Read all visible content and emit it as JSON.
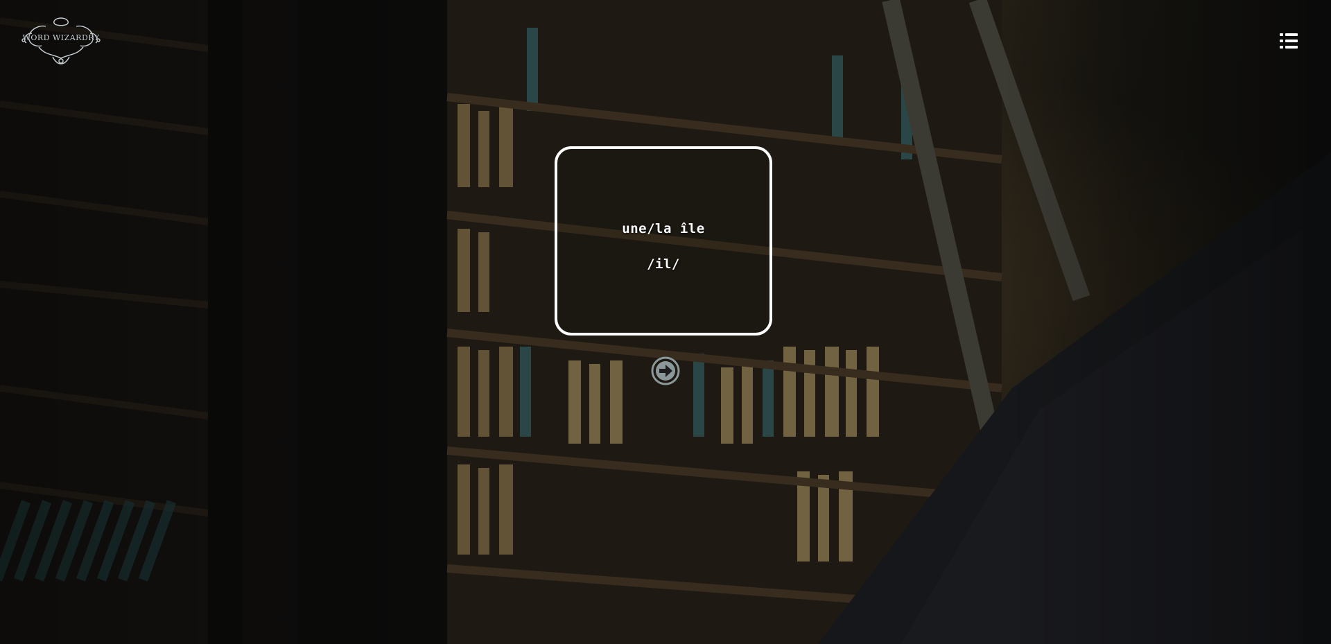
{
  "app": {
    "logo_text": "WORD WIZARDRY"
  },
  "header": {
    "menu_icon": "list-icon"
  },
  "flashcard": {
    "word": "une/la île",
    "phonetic": "/il/"
  },
  "controls": {
    "next_icon": "arrow-right-circle-icon"
  },
  "colors": {
    "card_border": "#ffffff",
    "text": "#ffffff",
    "next_button": "#8a9899",
    "logo": "#c9d2d6"
  }
}
